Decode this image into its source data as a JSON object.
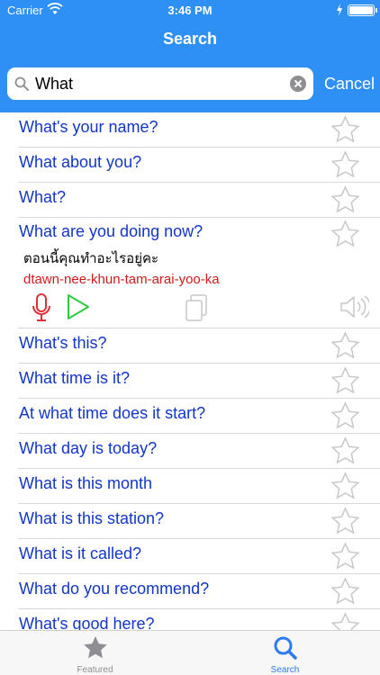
{
  "status": {
    "carrier": "Carrier",
    "time": "3:46 PM"
  },
  "nav": {
    "title": "Search"
  },
  "search": {
    "value": "What",
    "cancel_label": "Cancel"
  },
  "results": [
    "What's your name?",
    "What about you?",
    "What?",
    "What are you doing now?",
    "What's this?",
    "What time is it?",
    "At what time does it start?",
    "What day is today?",
    "What is this month",
    "What is this station?",
    "What is it called?",
    "What do you recommend?",
    "What's good here?"
  ],
  "expanded": {
    "thai": "ตอนนี้คุณทำอะไรอยู่คะ",
    "romanization": "dtawn-nee-khun-tam-arai-yoo-ka"
  },
  "tabs": [
    {
      "label": "Featured",
      "icon": "star-icon",
      "active": false
    },
    {
      "label": "Search",
      "icon": "search-icon",
      "active": true
    }
  ],
  "colors": {
    "nav_bar": "#2e8ff5",
    "phrase_text": "#1236c7",
    "romanization_text": "#d11b1b",
    "mic": "#e0303a",
    "play": "#2ecc40",
    "active_tab": "#2e7bf0"
  }
}
